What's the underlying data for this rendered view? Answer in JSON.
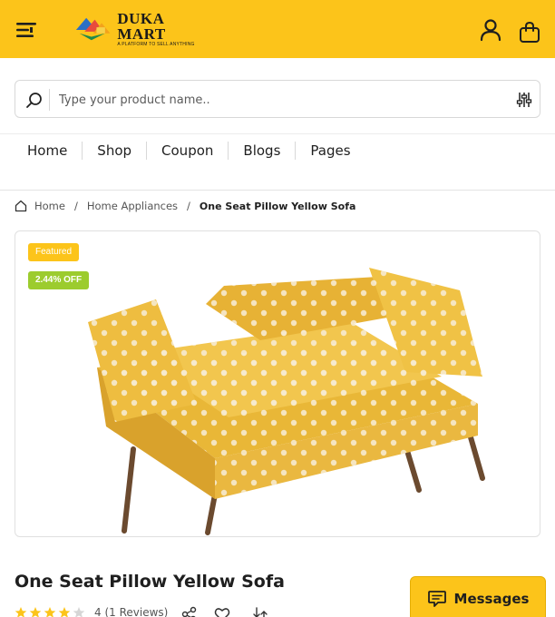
{
  "header": {
    "logo_name": "DUKA MART",
    "logo_tagline": "A PLATFORM TO SELL ANYTHING",
    "brand_color": "#fcc41a"
  },
  "search": {
    "placeholder": "Type your product name.."
  },
  "nav": {
    "items": [
      {
        "label": "Home"
      },
      {
        "label": "Shop"
      },
      {
        "label": "Coupon"
      },
      {
        "label": "Blogs"
      },
      {
        "label": "Pages"
      }
    ]
  },
  "breadcrumb": {
    "home": "Home",
    "category": "Home Appliances",
    "current": "One Seat Pillow Yellow Sofa",
    "separator": "/"
  },
  "product": {
    "badge_featured": "Featured",
    "badge_discount": "2.44% OFF",
    "title": "One Seat Pillow Yellow Sofa",
    "rating": 4,
    "rating_text": "4 (1 Reviews)",
    "badge_color": "#fcc41a",
    "discount_color": "#9ccc2e"
  },
  "messages": {
    "label": "Messages"
  },
  "icons": [
    "menu-icon",
    "user-icon",
    "bag-icon",
    "search-icon",
    "filter-icon",
    "home-icon",
    "star-icon",
    "share-icon",
    "heart-icon",
    "compare-icon",
    "chat-icon"
  ]
}
